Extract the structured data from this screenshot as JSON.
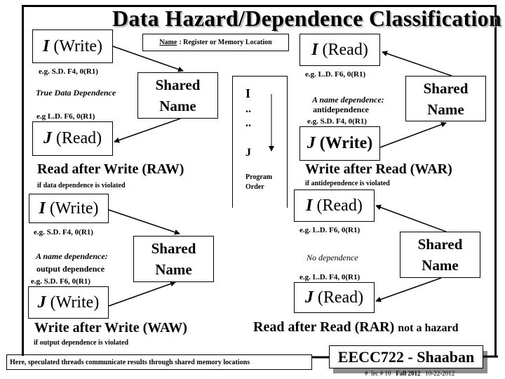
{
  "title": "Data Hazard/Dependence Classification",
  "name_note": {
    "label": "Name",
    "text": ": Register  or  Memory Location"
  },
  "shared_name": {
    "line1": "Shared",
    "line2": "Name"
  },
  "program_order": {
    "i": "I",
    "dots1": "..",
    "dots2": "..",
    "j": "J",
    "label_line1": "Program",
    "label_line2": "Order"
  },
  "raw": {
    "i_var": "I",
    "i_op": "(Write)",
    "i_example": "e.g.  S.D.  F4,  0(R1)",
    "dependence": "True Data Dependence",
    "j_example": "e.g  L.D.  F6,  0(R1)",
    "j_var": "J",
    "j_op": "(Read)",
    "hazard": "Read after Write  (RAW)",
    "condition": "if data dependence is violated"
  },
  "war": {
    "i_var": "I",
    "i_op": "(Read)",
    "i_example": "e.g.  L.D.  F6,  0(R1)",
    "dependence_line1": "A name dependence:",
    "dependence_line2": "antidependence",
    "j_example": "e.g.  S.D.  F4,   0(R1)",
    "j_var": "J",
    "j_op": "(Write)",
    "hazard": "Write after Read (WAR)",
    "condition": "if antidependence is violated"
  },
  "waw": {
    "i_var": "I",
    "i_op": "(Write)",
    "i_example": "e.g.  S.D.  F4,  0(R1)",
    "dependence_line1": "A name dependence:",
    "dependence_line2": "output dependence",
    "j_example": "e.g.  S.D.  F6,   0(R1)",
    "j_var": "J",
    "j_op": "(Write)",
    "hazard": "Write after Write  (WAW)",
    "condition": "if  output dependence is violated"
  },
  "rar": {
    "i_var": "I",
    "i_op": "(Read)",
    "i_example": "e.g.  L.D.  F6,  0(R1)",
    "dependence": "No dependence",
    "j_example": "e.g.  L.D.  F4,  0(R1)",
    "j_var": "J",
    "j_op": "(Read)",
    "hazard": "Read after Read  (RAR)",
    "hazard_suffix": "not a hazard"
  },
  "footer": {
    "note": "Here, speculated threads communicate results through shared memory locations",
    "badge": "EECC722 - Shaaban",
    "hash": "#",
    "lec": "lec # 10",
    "term": "Fall 2012",
    "date": "10-22-2012"
  }
}
